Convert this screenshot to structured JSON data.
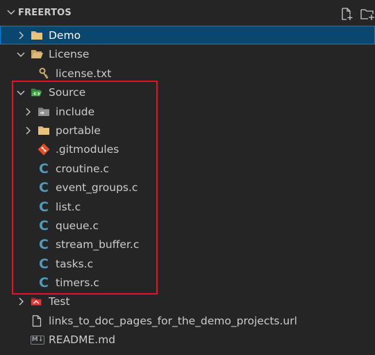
{
  "explorer": {
    "title": "FREERTOS",
    "actions": [
      {
        "name": "new-file-icon"
      },
      {
        "name": "new-folder-icon"
      }
    ]
  },
  "tree": {
    "demo": {
      "label": "Demo",
      "expanded": false,
      "selected": true,
      "icon": "folder-icon"
    },
    "license": {
      "label": "License",
      "expanded": true,
      "icon": "folder-open-icon"
    },
    "license_txt": {
      "label": "license.txt",
      "icon": "license-key-icon"
    },
    "source": {
      "label": "Source",
      "expanded": true,
      "icon": "folder-source-icon"
    },
    "include": {
      "label": "include",
      "expanded": false,
      "icon": "folder-include-icon"
    },
    "portable": {
      "label": "portable",
      "expanded": false,
      "icon": "folder-icon"
    },
    "gitmodules": {
      "label": ".gitmodules",
      "icon": "git-icon"
    },
    "croutine": {
      "label": "croutine.c",
      "icon": "c-file-icon"
    },
    "event_groups": {
      "label": "event_groups.c",
      "icon": "c-file-icon"
    },
    "list": {
      "label": "list.c",
      "icon": "c-file-icon"
    },
    "queue": {
      "label": "queue.c",
      "icon": "c-file-icon"
    },
    "stream_buffer": {
      "label": "stream_buffer.c",
      "icon": "c-file-icon"
    },
    "tasks": {
      "label": "tasks.c",
      "icon": "c-file-icon"
    },
    "timers": {
      "label": "timers.c",
      "icon": "c-file-icon"
    },
    "test": {
      "label": "Test",
      "expanded": false,
      "icon": "folder-test-icon"
    },
    "links_url": {
      "label": "links_to_doc_pages_for_the_demo_projects.url",
      "icon": "file-icon"
    },
    "readme": {
      "label": "README.md",
      "icon": "markdown-icon",
      "icon_text": "M↓"
    }
  },
  "colors": {
    "background": "#252526",
    "selection": "#094771",
    "selection_border": "#007fd4",
    "highlight_box": "#e81123",
    "c_icon": "#519aba",
    "folder": "#dcb67a"
  }
}
